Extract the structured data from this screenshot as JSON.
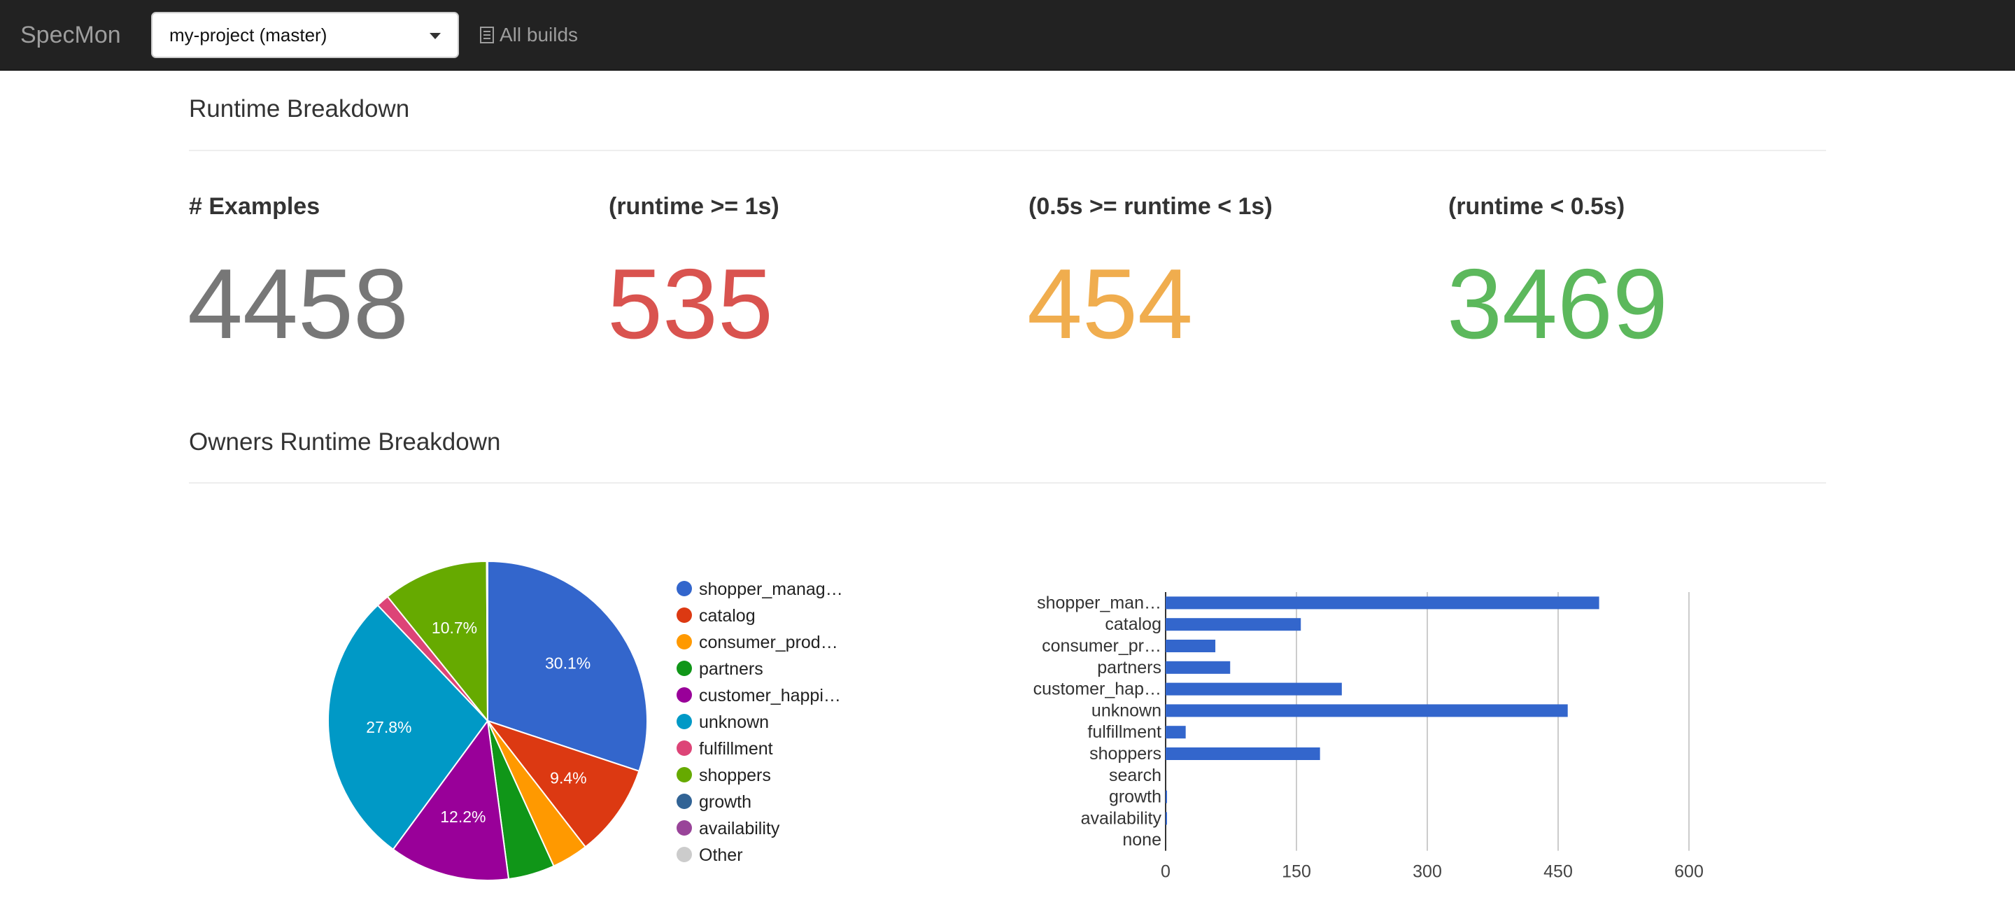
{
  "navbar": {
    "brand": "SpecMon",
    "project_select_value": "my-project (master)",
    "all_builds_label": "All builds"
  },
  "runtime_section": {
    "title": "Runtime Breakdown",
    "stats": [
      {
        "label": "# Examples",
        "value": "4458",
        "color": "#777777"
      },
      {
        "label": "(runtime >= 1s)",
        "value": "535",
        "color": "#d9534f"
      },
      {
        "label": "(0.5s >= runtime < 1s)",
        "value": "454",
        "color": "#f0ad4e"
      },
      {
        "label": "(runtime < 0.5s)",
        "value": "3469",
        "color": "#5cb85c"
      }
    ]
  },
  "owners_section": {
    "title": "Owners Runtime Breakdown"
  },
  "chart_data": [
    {
      "type": "pie",
      "slices": [
        {
          "label": "shopper_manag…",
          "value": 30.1,
          "pct_label": "30.1%",
          "color": "#3366cc"
        },
        {
          "label": "catalog",
          "value": 9.4,
          "pct_label": "9.4%",
          "color": "#dc3912"
        },
        {
          "label": "consumer_prod…",
          "value": 3.7,
          "pct_label": "",
          "color": "#ff9900"
        },
        {
          "label": "partners",
          "value": 4.7,
          "pct_label": "",
          "color": "#109618"
        },
        {
          "label": "customer_happi…",
          "value": 12.2,
          "pct_label": "12.2%",
          "color": "#990099"
        },
        {
          "label": "unknown",
          "value": 27.8,
          "pct_label": "27.8%",
          "color": "#0099c6"
        },
        {
          "label": "fulfillment",
          "value": 1.3,
          "pct_label": "",
          "color": "#dd4477"
        },
        {
          "label": "shoppers",
          "value": 10.7,
          "pct_label": "10.7%",
          "color": "#66aa00"
        },
        {
          "label": "growth",
          "value": 0.05,
          "pct_label": "",
          "color": "#316395"
        },
        {
          "label": "availability",
          "value": 0.05,
          "pct_label": "",
          "color": "#994499"
        },
        {
          "label": "Other",
          "value": 0.0,
          "pct_label": "",
          "color": "#cccccc"
        }
      ]
    },
    {
      "type": "bar",
      "orientation": "horizontal",
      "categories": [
        "shopper_man…",
        "catalog",
        "consumer_pr…",
        "partners",
        "customer_hap…",
        "unknown",
        "fulfillment",
        "shoppers",
        "search",
        "growth",
        "availability",
        "none"
      ],
      "values": [
        497,
        155,
        57,
        74,
        202,
        461,
        23,
        177,
        0,
        1,
        1,
        0
      ],
      "xlim": [
        0,
        600
      ],
      "xticks": [
        "0",
        "150",
        "300",
        "450",
        "600"
      ],
      "bar_color": "#3366cc",
      "grid": true
    }
  ]
}
